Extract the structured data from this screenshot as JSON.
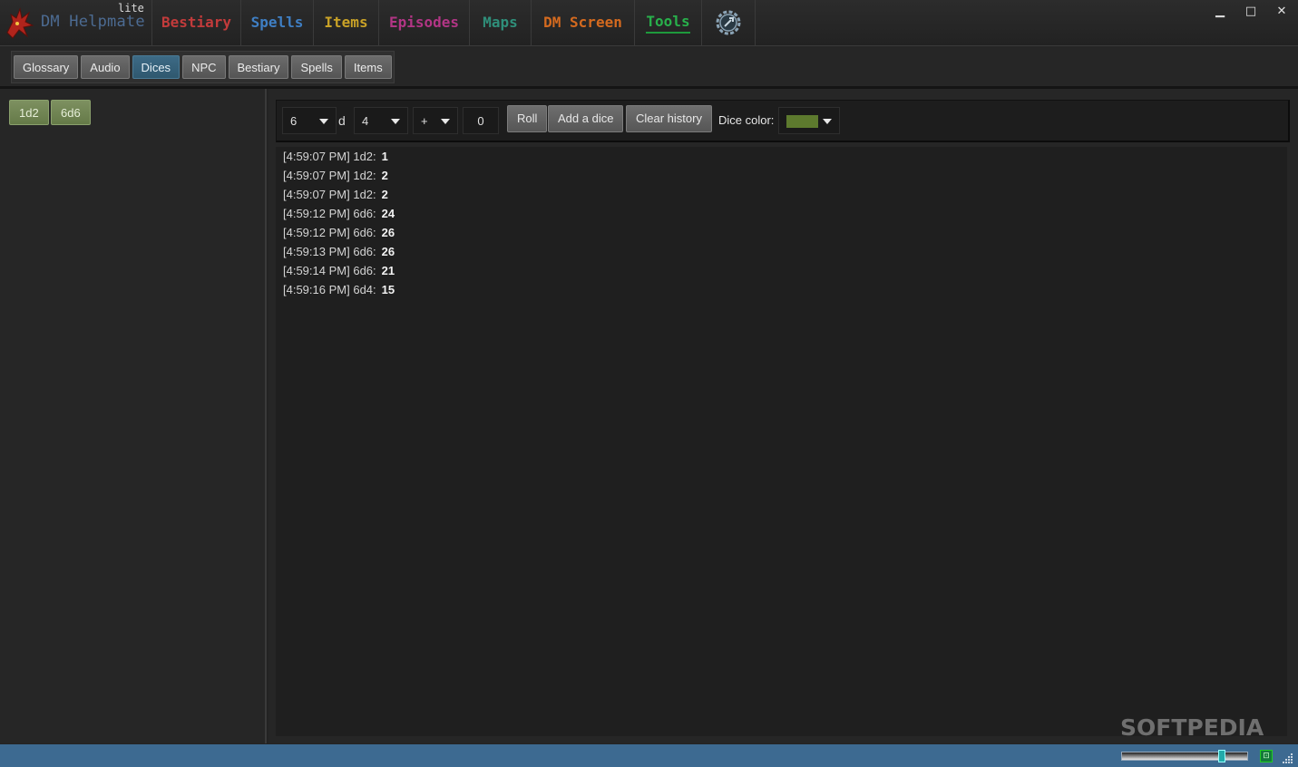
{
  "app": {
    "title": "DM Helpmate",
    "edition": "lite"
  },
  "nav": {
    "tabs": [
      {
        "label": "Bestiary",
        "color": "#c23b3b"
      },
      {
        "label": "Spells",
        "color": "#3f7fc4"
      },
      {
        "label": "Items",
        "color": "#c9a227"
      },
      {
        "label": "Episodes",
        "color": "#b23585"
      },
      {
        "label": "Maps",
        "color": "#2f8f7a"
      },
      {
        "label": "DM Screen",
        "color": "#d46a1f"
      },
      {
        "label": "Tools",
        "color": "#28b04b",
        "active": true
      }
    ],
    "settings_icon": "gear-icon"
  },
  "window_controls": {
    "minimize": "▁",
    "maximize": "□",
    "close": "✕"
  },
  "subtabs": [
    "Glossary",
    "Audio",
    "Dices",
    "NPC",
    "Bestiary",
    "Spells",
    "Items"
  ],
  "subtab_active": "Dices",
  "presets": [
    "1d2",
    "6d6"
  ],
  "roller": {
    "count": "6",
    "d_label": "d",
    "sides": "4",
    "operator": "+",
    "modifier": "0",
    "roll_label": "Roll",
    "add_label": "Add a dice",
    "clear_label": "Clear history",
    "color_label": "Dice color:",
    "dice_color": "#5d7a2e"
  },
  "history": [
    {
      "time": "[4:59:07 PM]",
      "dice": "1d2:",
      "result": "1"
    },
    {
      "time": "[4:59:07 PM]",
      "dice": "1d2:",
      "result": "2"
    },
    {
      "time": "[4:59:07 PM]",
      "dice": "1d2:",
      "result": "2"
    },
    {
      "time": "[4:59:12 PM]",
      "dice": "6d6:",
      "result": "24"
    },
    {
      "time": "[4:59:12 PM]",
      "dice": "6d6:",
      "result": "26"
    },
    {
      "time": "[4:59:13 PM]",
      "dice": "6d6:",
      "result": "26"
    },
    {
      "time": "[4:59:14 PM]",
      "dice": "6d6:",
      "result": "21"
    },
    {
      "time": "[4:59:16 PM]",
      "dice": "6d4:",
      "result": "15"
    }
  ],
  "statusbar": {
    "zoom_level": 0.8,
    "watermark": "SOFTPEDIA"
  }
}
